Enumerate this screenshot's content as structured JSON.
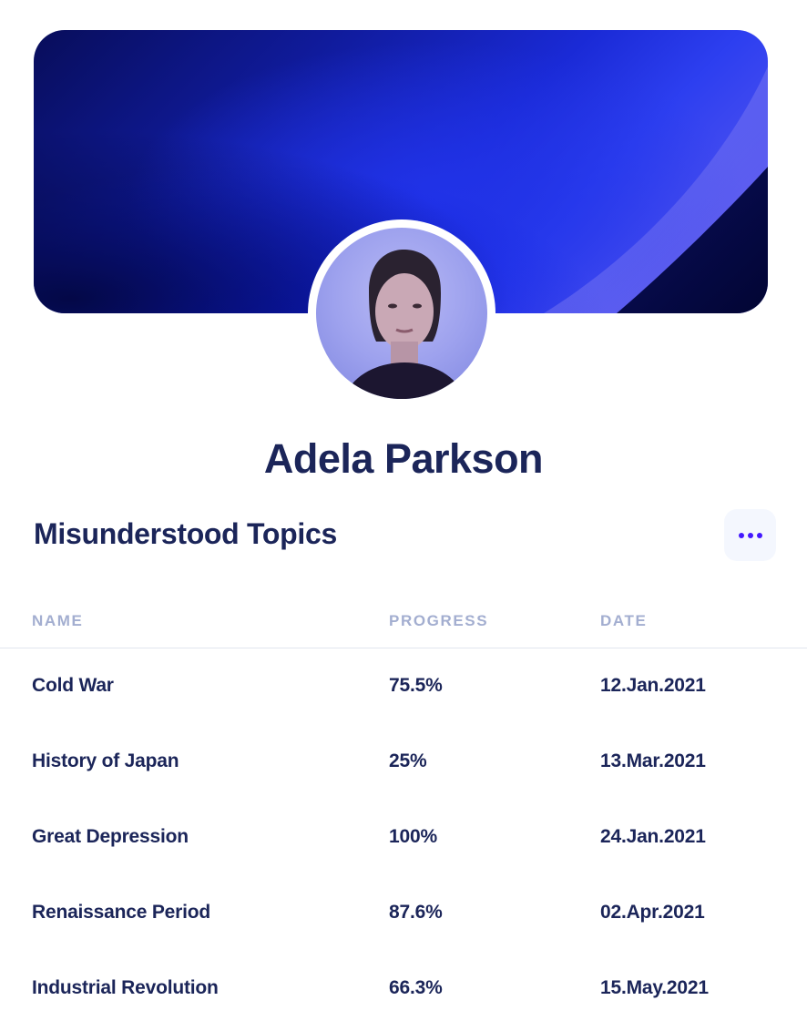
{
  "profile": {
    "name": "Adela Parkson"
  },
  "section": {
    "title": "Misunderstood Topics",
    "menu_icon": "more-horizontal-icon"
  },
  "colors": {
    "primary_text": "#1b2559",
    "muted_text": "#a3aed0",
    "accent": "#4318ff",
    "banner_gradient": [
      "#080d5a",
      "#1a2ad6",
      "#7e72f4"
    ]
  },
  "table": {
    "columns": [
      "NAME",
      "PROGRESS",
      "DATE"
    ],
    "rows": [
      {
        "name": "Cold War",
        "progress": "75.5%",
        "date": "12.Jan.2021"
      },
      {
        "name": "History of Japan",
        "progress": "25%",
        "date": "13.Mar.2021"
      },
      {
        "name": "Great Depression",
        "progress": "100%",
        "date": "24.Jan.2021"
      },
      {
        "name": "Renaissance Period",
        "progress": "87.6%",
        "date": "02.Apr.2021"
      },
      {
        "name": "Industrial Revolution",
        "progress": "66.3%",
        "date": "15.May.2021"
      }
    ]
  }
}
